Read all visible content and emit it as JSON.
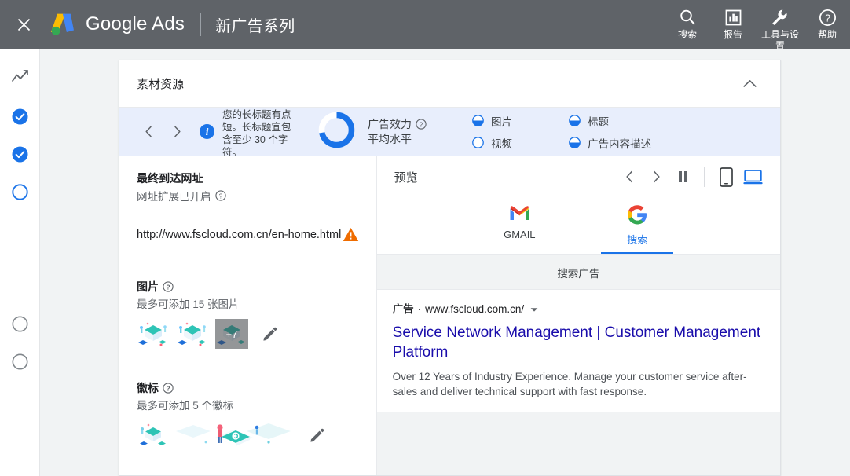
{
  "appbar": {
    "close_icon": "close-icon",
    "brand": "Google Ads",
    "campaign_title": "新广告系列",
    "actions": [
      {
        "icon": "search-icon",
        "label": "搜索"
      },
      {
        "icon": "reports-icon",
        "label": "报告"
      },
      {
        "icon": "tools-icon",
        "label": "工具与设置"
      },
      {
        "icon": "help-icon",
        "label": "帮助"
      }
    ]
  },
  "sidebar": {
    "top_icon": "trend-chart-icon",
    "steps": [
      {
        "name": "step-1",
        "state": "complete"
      },
      {
        "name": "step-2",
        "state": "complete"
      },
      {
        "name": "step-3",
        "state": "current"
      },
      {
        "name": "step-4",
        "state": "pending"
      },
      {
        "name": "step-5",
        "state": "pending"
      }
    ]
  },
  "card": {
    "title": "素材资源",
    "collapse_icon": "chevron-up-icon"
  },
  "banner": {
    "prev_icon": "chevron-left-icon",
    "next_icon": "chevron-right-icon",
    "info_icon": "info-icon",
    "message": "您的长标题有点短。长标题宜包含至少 30 个字符。",
    "strength_label": "广告效力",
    "strength_help_icon": "help-circle-icon",
    "strength_value": "平均水平",
    "donut_percent": 72,
    "donut_color": "#1a73e8",
    "checks_left": [
      {
        "label": "图片",
        "state": "half"
      },
      {
        "label": "视频",
        "state": "empty"
      }
    ],
    "checks_right": [
      {
        "label": "标题",
        "state": "half"
      },
      {
        "label": "广告内容描述",
        "state": "half"
      }
    ]
  },
  "form": {
    "final_url": {
      "label": "最终到达网址",
      "sub": "网址扩展已开启",
      "help_icon": "help-circle-icon",
      "value": "http://www.fscloud.com.cn/en-home.html",
      "warning_icon": "warning-triangle-icon"
    },
    "images": {
      "label": "图片",
      "help_icon": "help-circle-icon",
      "sub": "最多可添加 15 张图片",
      "more_count": "+7",
      "edit_icon": "pencil-icon"
    },
    "logos": {
      "label": "徽标",
      "help_icon": "help-circle-icon",
      "sub": "最多可添加 5 个徽标",
      "edit_icon": "pencil-icon"
    }
  },
  "preview": {
    "title": "预览",
    "prev_icon": "chevron-left-icon",
    "next_icon": "chevron-right-icon",
    "pause_icon": "pause-icon",
    "mobile_icon": "mobile-device-icon",
    "desktop_icon": "desktop-device-icon",
    "device_tabs": [
      {
        "icon": "gmail-icon",
        "label": "GMAIL",
        "active": false
      },
      {
        "icon": "google-g-icon",
        "label": "搜索",
        "active": true
      }
    ],
    "section_label": "搜索广告",
    "ad": {
      "badge": "广告",
      "separator": "·",
      "display_url": "www.fscloud.com.cn/",
      "caret_icon": "caret-down-icon",
      "headline": "Service Network Management | Customer Management Platform",
      "description": "Over 12 Years of Industry Experience. Manage your customer service after-sales and deliver technical support with fast response."
    }
  }
}
